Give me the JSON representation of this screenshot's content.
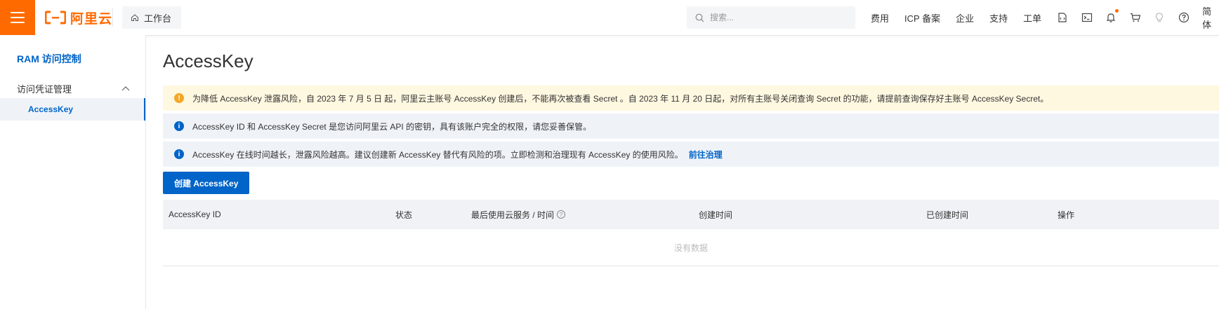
{
  "header": {
    "logo_text": "阿里云",
    "workbench_label": "工作台",
    "search_placeholder": "搜索...",
    "nav_links": [
      "费用",
      "ICP 备案",
      "企业",
      "支持",
      "工单"
    ],
    "language": "简体",
    "brand_color": "#ff6a00"
  },
  "sidebar": {
    "title": "RAM 访问控制",
    "group_label": "访问凭证管理",
    "active_item": "AccessKey"
  },
  "main": {
    "page_title": "AccessKey",
    "alerts": {
      "warning": "为降低 AccessKey 泄露风险，自 2023 年 7 月 5 日 起，阿里云主账号 AccessKey 创建后，不能再次被查看 Secret 。自 2023 年 11 月 20 日起，对所有主账号关闭查询 Secret 的功能，请提前查询保存好主账号 AccessKey Secret。",
      "info1": "AccessKey ID 和 AccessKey Secret 是您访问阿里云 API 的密钥，具有该账户完全的权限，请您妥善保管。",
      "info2": "AccessKey 在线时间越长，泄露风险越高。建议创建新 AccessKey 替代有风险的项。立即检测和治理现有 AccessKey 的使用风险。",
      "info2_link": "前往治理"
    },
    "create_button": "创建 AccessKey",
    "table": {
      "columns": [
        "AccessKey ID",
        "状态",
        "最后使用云服务 / 时间",
        "创建时间",
        "已创建时间",
        "操作"
      ],
      "empty_text": "没有数据"
    },
    "accent_color": "#0064c8"
  }
}
